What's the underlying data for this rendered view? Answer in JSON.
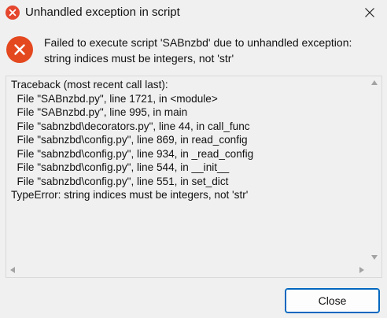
{
  "window": {
    "title": "Unhandled exception in script",
    "accent_color": "#0067c0",
    "error_color": "#e4481f"
  },
  "message": {
    "line1": "Failed to execute script 'SABnzbd' due to unhandled exception:",
    "line2": "string indices must be integers, not 'str'"
  },
  "traceback": {
    "lines": [
      "Traceback (most recent call last):",
      "  File \"SABnzbd.py\", line 1721, in <module>",
      "  File \"SABnzbd.py\", line 995, in main",
      "  File \"sabnzbd\\decorators.py\", line 44, in call_func",
      "  File \"sabnzbd\\config.py\", line 869, in read_config",
      "  File \"sabnzbd\\config.py\", line 934, in _read_config",
      "  File \"sabnzbd\\config.py\", line 544, in __init__",
      "  File \"sabnzbd\\config.py\", line 551, in set_dict",
      "TypeError: string indices must be integers, not 'str'"
    ]
  },
  "buttons": {
    "close_label": "Close"
  },
  "icons": {
    "title": "error-icon",
    "message": "error-icon",
    "window_close": "close-icon"
  }
}
